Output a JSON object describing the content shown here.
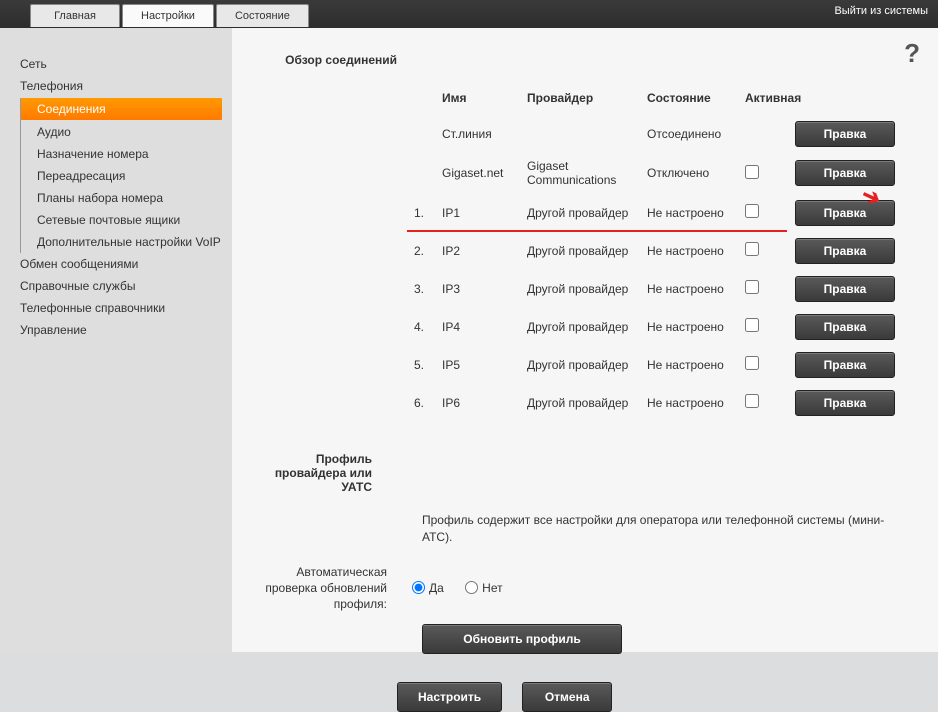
{
  "topbar": {
    "tabs": [
      "Главная",
      "Настройки",
      "Состояние"
    ],
    "active_tab": 1,
    "logout": "Выйти из системы"
  },
  "help_icon": "?",
  "sidebar": {
    "items": [
      {
        "label": "Сеть",
        "type": "top"
      },
      {
        "label": "Телефония",
        "type": "top"
      },
      {
        "label": "Соединения",
        "type": "sub",
        "active": true
      },
      {
        "label": "Аудио",
        "type": "sub"
      },
      {
        "label": "Назначение номера",
        "type": "sub"
      },
      {
        "label": "Переадресация",
        "type": "sub"
      },
      {
        "label": "Планы набора номера",
        "type": "sub"
      },
      {
        "label": "Сетевые почтовые ящики",
        "type": "sub"
      },
      {
        "label": "Дополнительные настройки VoIP",
        "type": "sub"
      },
      {
        "label": "Обмен сообщениями",
        "type": "top"
      },
      {
        "label": "Справочные службы",
        "type": "top"
      },
      {
        "label": "Телефонные справочники",
        "type": "top"
      },
      {
        "label": "Управление",
        "type": "top"
      }
    ]
  },
  "content": {
    "overview_title": "Обзор соединений",
    "headers": {
      "name": "Имя",
      "provider": "Провайдер",
      "state": "Состояние",
      "active": "Активная"
    },
    "edit_label": "Правка",
    "rows": [
      {
        "num": "",
        "name": "Ст.линия",
        "provider": "",
        "state": "Отсоединено",
        "show_checkbox": false
      },
      {
        "num": "",
        "name": "Gigaset.net",
        "provider": "Gigaset Communications",
        "state": "Отключено",
        "show_checkbox": true
      },
      {
        "num": "1.",
        "name": "IP1",
        "provider": "Другой провайдер",
        "state": "Не настроено",
        "show_checkbox": true,
        "highlight": true
      },
      {
        "num": "2.",
        "name": "IP2",
        "provider": "Другой провайдер",
        "state": "Не настроено",
        "show_checkbox": true
      },
      {
        "num": "3.",
        "name": "IP3",
        "provider": "Другой провайдер",
        "state": "Не настроено",
        "show_checkbox": true
      },
      {
        "num": "4.",
        "name": "IP4",
        "provider": "Другой провайдер",
        "state": "Не настроено",
        "show_checkbox": true
      },
      {
        "num": "5.",
        "name": "IP5",
        "provider": "Другой провайдер",
        "state": "Не настроено",
        "show_checkbox": true
      },
      {
        "num": "6.",
        "name": "IP6",
        "provider": "Другой провайдер",
        "state": "Не настроено",
        "show_checkbox": true
      }
    ],
    "profile_section_title": "Профиль провайдера или УАТС",
    "profile_desc": "Профиль содержит все настройки для оператора или телефонной системы (мини-АТС).",
    "auto_update_label": "Автоматическая проверка обновлений профиля:",
    "yes": "Да",
    "no": "Нет",
    "update_profile_btn": "Обновить профиль",
    "configure_btn": "Настроить",
    "cancel_btn": "Отмена"
  }
}
